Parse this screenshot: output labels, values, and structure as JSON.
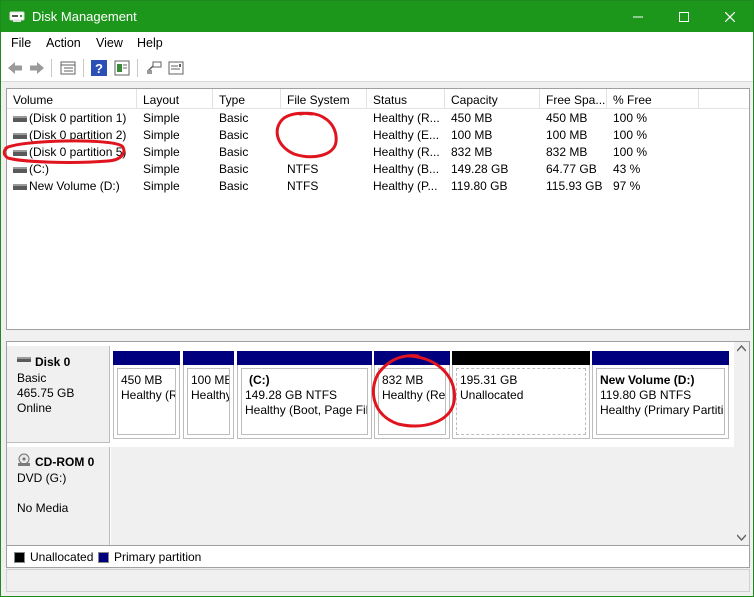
{
  "window": {
    "title": "Disk Management",
    "accent": "#1c971c"
  },
  "menu": {
    "items": [
      "File",
      "Action",
      "View",
      "Help"
    ]
  },
  "toolbar": {
    "icons": [
      "back-icon",
      "forward-icon",
      "list-view-icon",
      "help-icon",
      "properties-icon",
      "connect-icon",
      "settings-icon"
    ]
  },
  "table": {
    "columns": [
      "Volume",
      "Layout",
      "Type",
      "File System",
      "Status",
      "Capacity",
      "Free Spa...",
      "% Free"
    ],
    "rows": [
      {
        "volume": "(Disk 0 partition 1)",
        "layout": "Simple",
        "type": "Basic",
        "fs": "",
        "status": "Healthy (R...",
        "capacity": "450 MB",
        "free": "450 MB",
        "pct": "100 %"
      },
      {
        "volume": "(Disk 0 partition 2)",
        "layout": "Simple",
        "type": "Basic",
        "fs": "",
        "status": "Healthy (E...",
        "capacity": "100 MB",
        "free": "100 MB",
        "pct": "100 %"
      },
      {
        "volume": "(Disk 0 partition 5)",
        "layout": "Simple",
        "type": "Basic",
        "fs": "",
        "status": "Healthy (R...",
        "capacity": "832 MB",
        "free": "832 MB",
        "pct": "100 %"
      },
      {
        "volume": "(C:)",
        "layout": "Simple",
        "type": "Basic",
        "fs": "NTFS",
        "status": "Healthy (B...",
        "capacity": "149.28 GB",
        "free": "64.77 GB",
        "pct": "43 %"
      },
      {
        "volume": "New Volume (D:)",
        "layout": "Simple",
        "type": "Basic",
        "fs": "NTFS",
        "status": "Healthy (P...",
        "capacity": "119.80 GB",
        "free": "115.93 GB",
        "pct": "97 %"
      }
    ]
  },
  "disks": {
    "disk0": {
      "name": "Disk 0",
      "kind": "Basic",
      "size": "465.75 GB",
      "state": "Online",
      "partitions": [
        {
          "name": "",
          "line1": "450 MB",
          "line2": "Healthy (R",
          "bar": "#00007f"
        },
        {
          "name": "",
          "line1": "100 MB",
          "line2": "Healthy",
          "bar": "#00007f"
        },
        {
          "name": "(C:)",
          "line1": "149.28 GB NTFS",
          "line2": "Healthy (Boot, Page File",
          "bar": "#00007f"
        },
        {
          "name": "",
          "line1": "832 MB",
          "line2": "Healthy (Re",
          "bar": "#00007f"
        },
        {
          "name": "",
          "line1": "195.31 GB",
          "line2": "Unallocated",
          "bar": "#000000"
        },
        {
          "name": "New Volume  (D:)",
          "line1": "119.80 GB NTFS",
          "line2": "Healthy (Primary Partiti",
          "bar": "#00007f"
        }
      ]
    },
    "cdrom0": {
      "name": "CD-ROM 0",
      "kind": "DVD (G:)",
      "state": "No Media"
    }
  },
  "legend": [
    {
      "label": "Unallocated",
      "color": "#000000"
    },
    {
      "label": "Primary partition",
      "color": "#00007f"
    }
  ],
  "annotation_color": "#e0141e"
}
